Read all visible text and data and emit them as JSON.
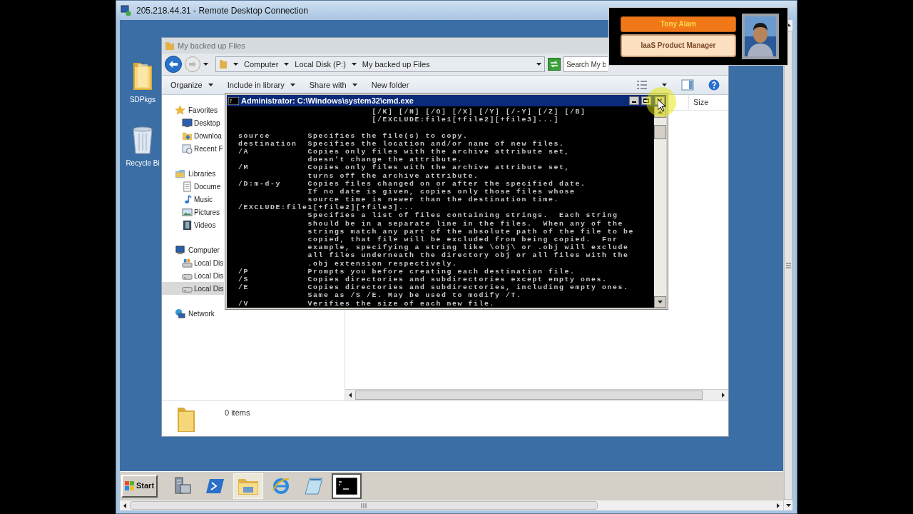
{
  "remote_window": {
    "title": "205.218.44.31 - Remote Desktop Connection"
  },
  "desktop_icons": [
    {
      "label": "SDPkgs",
      "kind": "folder"
    },
    {
      "label": "Recycle Bi",
      "kind": "recycle"
    }
  ],
  "explorer": {
    "title": "My backed up Files",
    "breadcrumb": [
      "Computer",
      "Local Disk (P:)",
      "My backed up Files"
    ],
    "search": {
      "placeholder": "Search My b"
    },
    "toolbar": [
      {
        "label": "Organize",
        "dropdown": true
      },
      {
        "label": "Include in library",
        "dropdown": true
      },
      {
        "label": "Share with",
        "dropdown": true
      },
      {
        "label": "New folder",
        "dropdown": false
      }
    ],
    "nav": [
      {
        "label": "Favorites",
        "kind": "star",
        "selected": false,
        "children": [
          {
            "label": "Desktop",
            "kind": "monitor",
            "selected": false
          },
          {
            "label": "Downloa",
            "kind": "download",
            "selected": false
          },
          {
            "label": "Recent F",
            "kind": "recent",
            "selected": false
          }
        ]
      },
      {
        "label": "Libraries",
        "kind": "library",
        "selected": false,
        "children": [
          {
            "label": "Docume",
            "kind": "document",
            "selected": false
          },
          {
            "label": "Music",
            "kind": "music",
            "selected": false
          },
          {
            "label": "Pictures",
            "kind": "picture",
            "selected": false
          },
          {
            "label": "Videos",
            "kind": "video",
            "selected": false
          }
        ]
      },
      {
        "label": "Computer",
        "kind": "computer",
        "selected": false,
        "children": [
          {
            "label": "Local Dis",
            "kind": "system-disk",
            "selected": false
          },
          {
            "label": "Local Dis",
            "kind": "disk",
            "selected": false
          },
          {
            "label": "Local Dis",
            "kind": "disk",
            "selected": true
          }
        ]
      },
      {
        "label": "Network",
        "kind": "network",
        "selected": false
      }
    ],
    "columns": [
      "Size"
    ],
    "status": "0 items"
  },
  "cmd": {
    "title": "Administrator: C:\\Windows\\system32\\cmd.exe",
    "blocks": [
      [
        "                         [/K] [/N] [/O] [/X] [/Y] [/-Y] [/Z] [/B]",
        "                         [/EXCLUDE:file1[+file2][+file3]...]"
      ],
      [
        "source       Specifies the file(s) to copy.",
        "destination  Specifies the location and/or name of new files.",
        "/A           Copies only files with the archive attribute set,",
        "             doesn't change the attribute.",
        "/M           Copies only files with the archive attribute set,",
        "             turns off the archive attribute.",
        "/D:m-d-y     Copies files changed on or after the specified date.",
        "             If no date is given, copies only those files whose",
        "             source time is newer than the destination time.",
        "/EXCLUDE:file1[+file2][+file3]...",
        "             Specifies a list of files containing strings.  Each string",
        "             should be in a separate line in the files.  When any of the",
        "             strings match any part of the absolute path of the file to be",
        "             copied, that file will be excluded from being copied.  For",
        "             example, specifying a string like \\obj\\ or .obj will exclude",
        "             all files underneath the directory obj or all files with the",
        "             .obj extension respectively.",
        "/P           Prompts you before creating each destination file.",
        "/S           Copies directories and subdirectories except empty ones.",
        "/E           Copies directories and subdirectories, including empty ones.",
        "             Same as /S /E. May be used to modify /T.",
        "/V           Verifies the size of each new file."
      ]
    ]
  },
  "taskbar": {
    "start": "Start",
    "apps": [
      {
        "kind": "server",
        "open": false,
        "selected": false
      },
      {
        "kind": "powershell",
        "open": false,
        "selected": false
      },
      {
        "kind": "explorer",
        "open": true,
        "selected": false
      },
      {
        "kind": "browser",
        "open": false,
        "selected": false
      },
      {
        "kind": "notepad",
        "open": false,
        "selected": false
      },
      {
        "kind": "cmd",
        "open": true,
        "selected": true
      }
    ]
  },
  "presenter": {
    "name": "Tony Alam",
    "role": "IaaS Product Manager"
  }
}
